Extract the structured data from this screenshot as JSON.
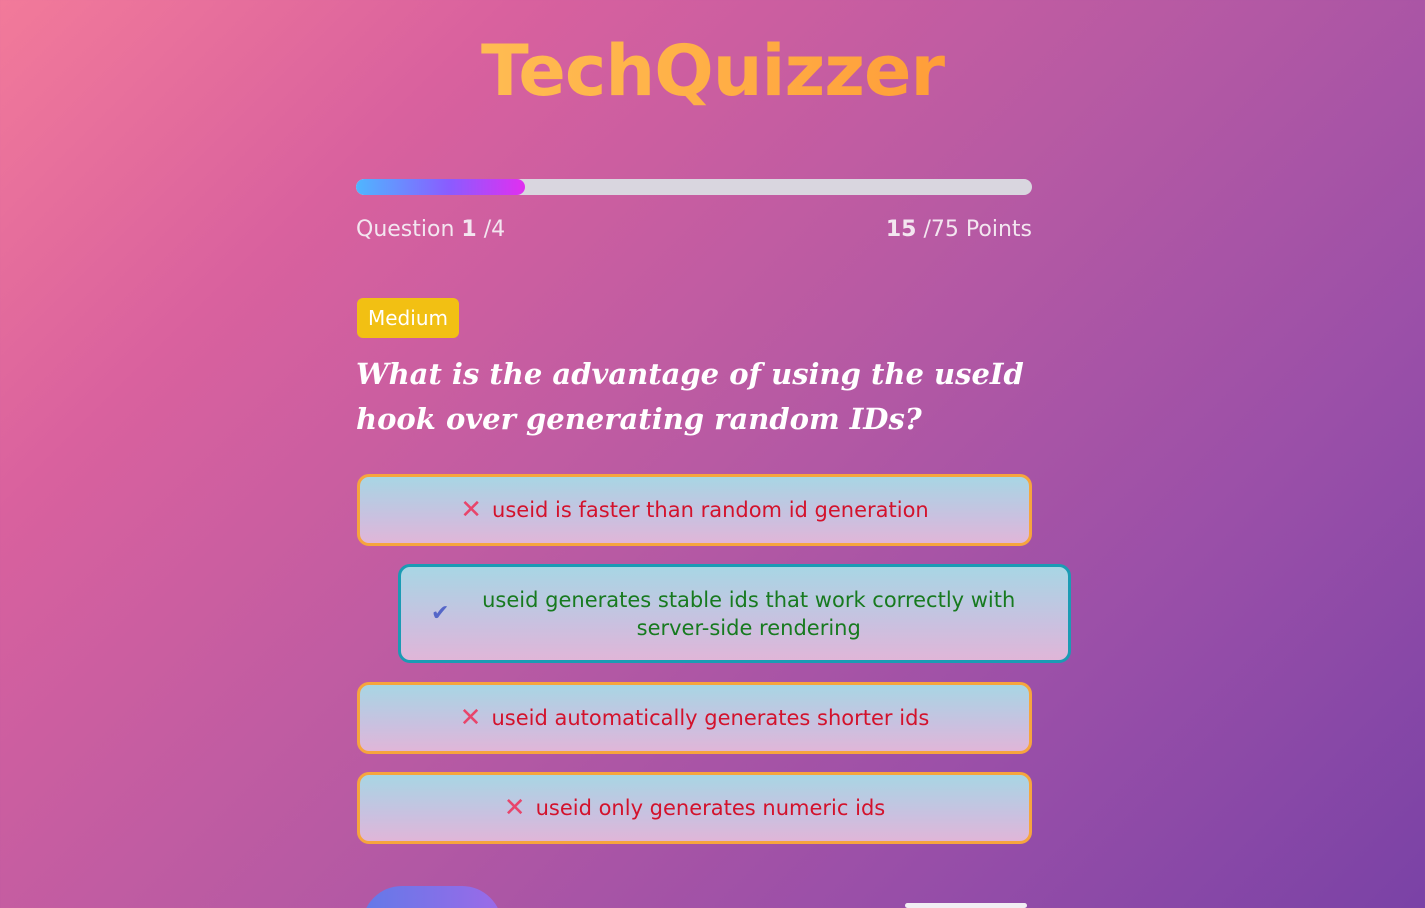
{
  "app": {
    "title": "TechQuizzer"
  },
  "progress": {
    "fraction": 0.25,
    "question_label": "Question",
    "current": "1",
    "total": "/4",
    "score": "15",
    "score_total": "/75 Points"
  },
  "question": {
    "difficulty": "Medium",
    "text": "What is the advantage of using the useId hook over generating random IDs?",
    "options": [
      {
        "label": "useid is faster than random id generation",
        "status": "wrong",
        "icon": "close-icon"
      },
      {
        "label": "useid generates stable ids that work correctly with server-side rendering",
        "status": "correct",
        "icon": "check-icon"
      },
      {
        "label": "useid automatically generates shorter ids",
        "status": "wrong",
        "icon": "close-icon"
      },
      {
        "label": "useid only generates numeric ids",
        "status": "wrong",
        "icon": "close-icon"
      }
    ]
  },
  "colors": {
    "accent_yellow": "#f2c013",
    "wrong_border": "#f6a53d",
    "wrong_text": "#d3122c",
    "correct_border": "#1b9bb4",
    "correct_text": "#177a1f"
  }
}
